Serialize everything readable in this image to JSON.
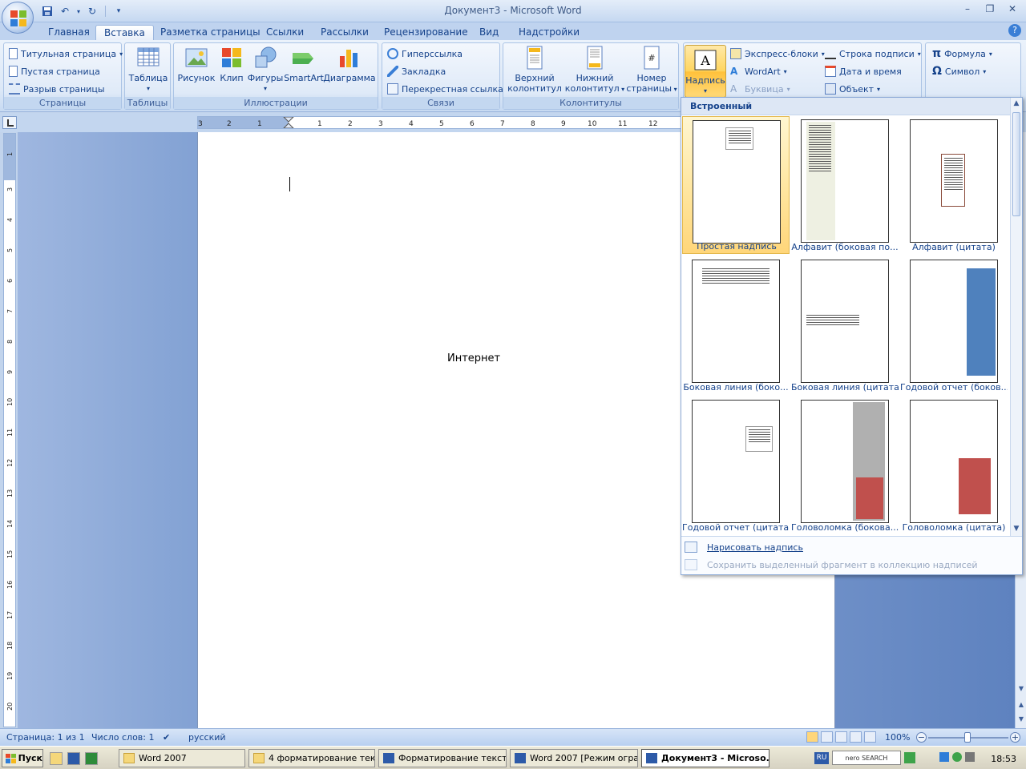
{
  "window": {
    "title": "Документ3 - Microsoft Word"
  },
  "tabs": [
    "Главная",
    "Вставка",
    "Разметка страницы",
    "Ссылки",
    "Рассылки",
    "Рецензирование",
    "Вид",
    "Надстройки"
  ],
  "ribbon": {
    "pages": {
      "title_page": "Титульная страница",
      "blank_page": "Пустая страница",
      "page_break": "Разрыв страницы",
      "label": "Страницы"
    },
    "tables": {
      "table": "Таблица",
      "label": "Таблицы"
    },
    "illustrations": {
      "picture": "Рисунок",
      "clip": "Клип",
      "shapes": "Фигуры",
      "smartart": "SmartArt",
      "chart": "Диаграмма",
      "label": "Иллюстрации"
    },
    "links": {
      "hyperlink": "Гиперссылка",
      "bookmark": "Закладка",
      "crossref": "Перекрестная ссылка",
      "label": "Связи"
    },
    "header_footer": {
      "header_1": "Верхний",
      "header_2": "колонтитул",
      "footer_1": "Нижний",
      "footer_2": "колонтитул",
      "pagenum_1": "Номер",
      "pagenum_2": "страницы",
      "label": "Колонтитулы"
    },
    "text": {
      "textbox": "Надпись",
      "quickparts": "Экспресс-блоки",
      "wordart": "WordArt",
      "dropcap": "Буквица",
      "signature": "Строка подписи",
      "datetime": "Дата и время",
      "object": "Объект"
    },
    "symbols": {
      "equation": "Формула",
      "symbol": "Символ"
    }
  },
  "document": {
    "text": "Интернет"
  },
  "gallery": {
    "header": "Встроенный",
    "items": [
      "Простая надпись",
      "Алфавит (боковая по...",
      "Алфавит (цитата)",
      "Боковая линия (боко...",
      "Боковая линия (цитата)",
      "Годовой отчет (боков...",
      "Годовой отчет (цитата)",
      "Головоломка (бокова...",
      "Головоломка (цитата)"
    ],
    "draw": "Нарисовать надпись",
    "save": "Сохранить выделенный фрагмент в коллекцию надписей"
  },
  "status": {
    "page": "Страница: 1 из 1",
    "words": "Число слов: 1",
    "lang": "русский",
    "zoom": "100%",
    "zoom_level": 100
  },
  "taskbar": {
    "start": "Пуск",
    "tasks": [
      "Word 2007",
      "4 форматирование тек...",
      "Форматирование текст...",
      "Word 2007 [Режим огра...",
      "Документ3 - Microso..."
    ],
    "lang": "RU",
    "search": "nero SEARCH",
    "time": "18:53"
  },
  "colors": {
    "accent": "#15428b",
    "selected_item": "#ffd67a"
  }
}
